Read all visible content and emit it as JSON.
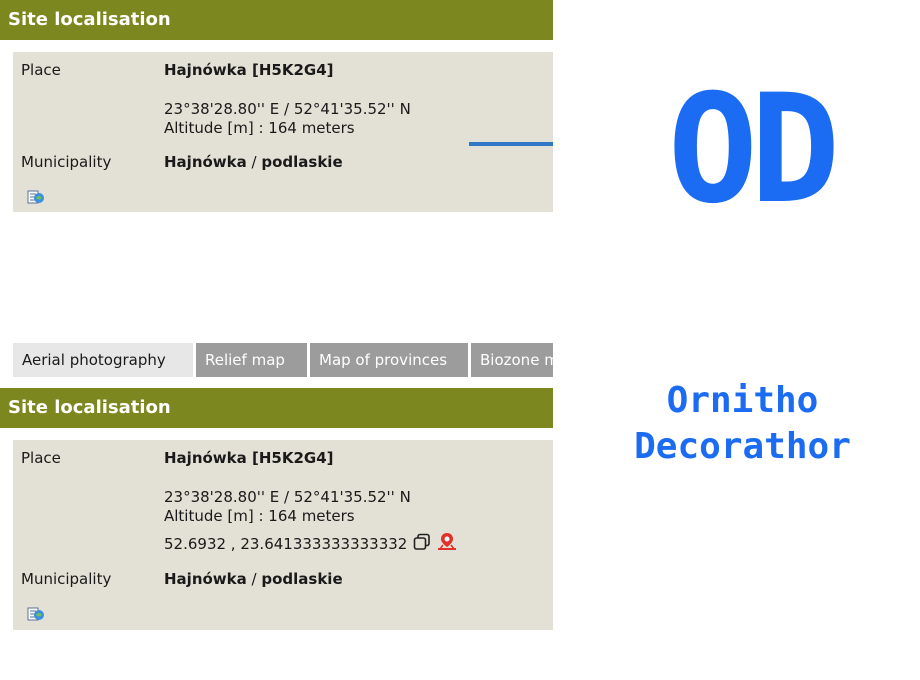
{
  "top_section": {
    "header": "Site localisation",
    "place_label": "Place",
    "place_value": "Hajnówka [H5K2G4]",
    "coords": "23°38'28.80'' E / 52°41'35.52'' N",
    "altitude": "Altitude [m] : 164 meters",
    "municipality_label": "Municipality",
    "municipality_name": "Hajnówka",
    "municipality_sep": " / ",
    "municipality_region": "podlaskie"
  },
  "tabs": [
    {
      "label": "Aerial photography",
      "active": true
    },
    {
      "label": "Relief map",
      "active": false
    },
    {
      "label": "Map of provinces",
      "active": false
    },
    {
      "label": "Biozone m",
      "active": false
    }
  ],
  "bottom_section": {
    "header": "Site localisation",
    "place_label": "Place",
    "place_value": "Hajnówka [H5K2G4]",
    "coords": "23°38'28.80'' E / 52°41'35.52'' N",
    "altitude": "Altitude [m] : 164 meters",
    "decimal_coords": "52.6932 , 23.641333333333332",
    "municipality_label": "Municipality",
    "municipality_name": "Hajnówka",
    "municipality_sep": " / ",
    "municipality_region": "podlaskie"
  },
  "logo": {
    "short": "OD",
    "line1": "Ornitho",
    "line2": "Decorathor",
    "color": "#1b6cf2"
  },
  "colors": {
    "header_bg": "#7c871f",
    "panel_bg": "#e3e1d5",
    "tab_inactive_bg": "#9c9c9c",
    "accent_line": "#2f78c8",
    "map_pin": "#e0322a"
  },
  "icons": [
    "map-export-icon",
    "copy-icon",
    "map-pin-icon"
  ]
}
